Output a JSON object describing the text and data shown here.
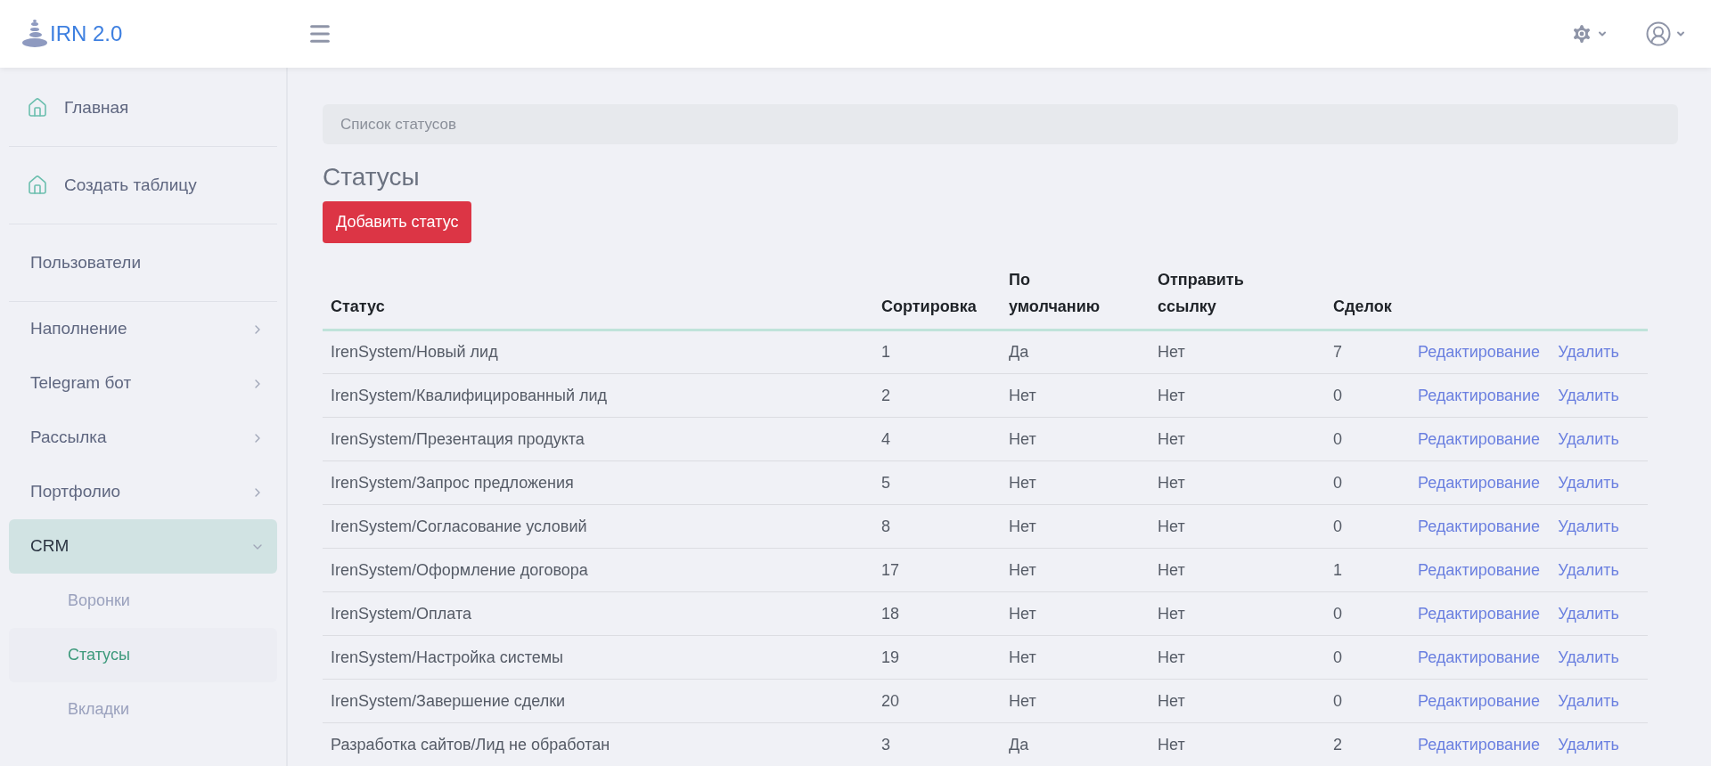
{
  "header": {
    "logo": "IRN 2.0"
  },
  "sidebar": {
    "items": [
      {
        "label": "Главная",
        "kind": "home",
        "selected": false
      },
      {
        "label": "Создать таблицу",
        "kind": "home",
        "selected": false
      },
      {
        "label": "Пользователи",
        "kind": "plain",
        "selected": false
      },
      {
        "label": "Наполнение",
        "kind": "group",
        "selected": false,
        "expanded": false
      },
      {
        "label": "Telegram бот",
        "kind": "group",
        "selected": false,
        "expanded": false
      },
      {
        "label": "Рассылка",
        "kind": "group",
        "selected": false,
        "expanded": false
      },
      {
        "label": "Портфолио",
        "kind": "group",
        "selected": false,
        "expanded": false
      },
      {
        "label": "CRM",
        "kind": "group",
        "selected": true,
        "expanded": true,
        "children": [
          {
            "label": "Воронки",
            "selected": false
          },
          {
            "label": "Статусы",
            "selected": true
          },
          {
            "label": "Вкладки",
            "selected": false
          }
        ]
      }
    ]
  },
  "breadcrumb": "Список статусов",
  "title": "Статусы",
  "add_button": "Добавить статус",
  "table": {
    "columns": [
      "Статус",
      "Сортировка",
      "По умолчанию",
      "Отправить ссылку",
      "Сделок"
    ],
    "rows": [
      {
        "cells": [
          "IrenSystem/Новый лид",
          "1",
          "Да",
          "Нет",
          "7"
        ],
        "actions": [
          "Редактирование",
          "Удалить"
        ]
      },
      {
        "cells": [
          "IrenSystem/Квалифицированный лид",
          "2",
          "Нет",
          "Нет",
          "0"
        ],
        "actions": [
          "Редактирование",
          "Удалить"
        ]
      },
      {
        "cells": [
          "IrenSystem/Презентация продукта",
          "4",
          "Нет",
          "Нет",
          "0"
        ],
        "actions": [
          "Редактирование",
          "Удалить"
        ]
      },
      {
        "cells": [
          "IrenSystem/Запрос предложения",
          "5",
          "Нет",
          "Нет",
          "0"
        ],
        "actions": [
          "Редактирование",
          "Удалить"
        ]
      },
      {
        "cells": [
          "IrenSystem/Согласование условий",
          "8",
          "Нет",
          "Нет",
          "0"
        ],
        "actions": [
          "Редактирование",
          "Удалить"
        ]
      },
      {
        "cells": [
          "IrenSystem/Оформление договора",
          "17",
          "Нет",
          "Нет",
          "1"
        ],
        "actions": [
          "Редактирование",
          "Удалить"
        ]
      },
      {
        "cells": [
          "IrenSystem/Оплата",
          "18",
          "Нет",
          "Нет",
          "0"
        ],
        "actions": [
          "Редактирование",
          "Удалить"
        ]
      },
      {
        "cells": [
          "IrenSystem/Настройка системы",
          "19",
          "Нет",
          "Нет",
          "0"
        ],
        "actions": [
          "Редактирование",
          "Удалить"
        ]
      },
      {
        "cells": [
          "IrenSystem/Завершение сделки",
          "20",
          "Нет",
          "Нет",
          "0"
        ],
        "actions": [
          "Редактирование",
          "Удалить"
        ]
      },
      {
        "cells": [
          "Разработка сайтов/Лид не обработан",
          "3",
          "Да",
          "Нет",
          "2"
        ],
        "actions": [
          "Редактирование",
          "Удалить"
        ]
      }
    ]
  }
}
